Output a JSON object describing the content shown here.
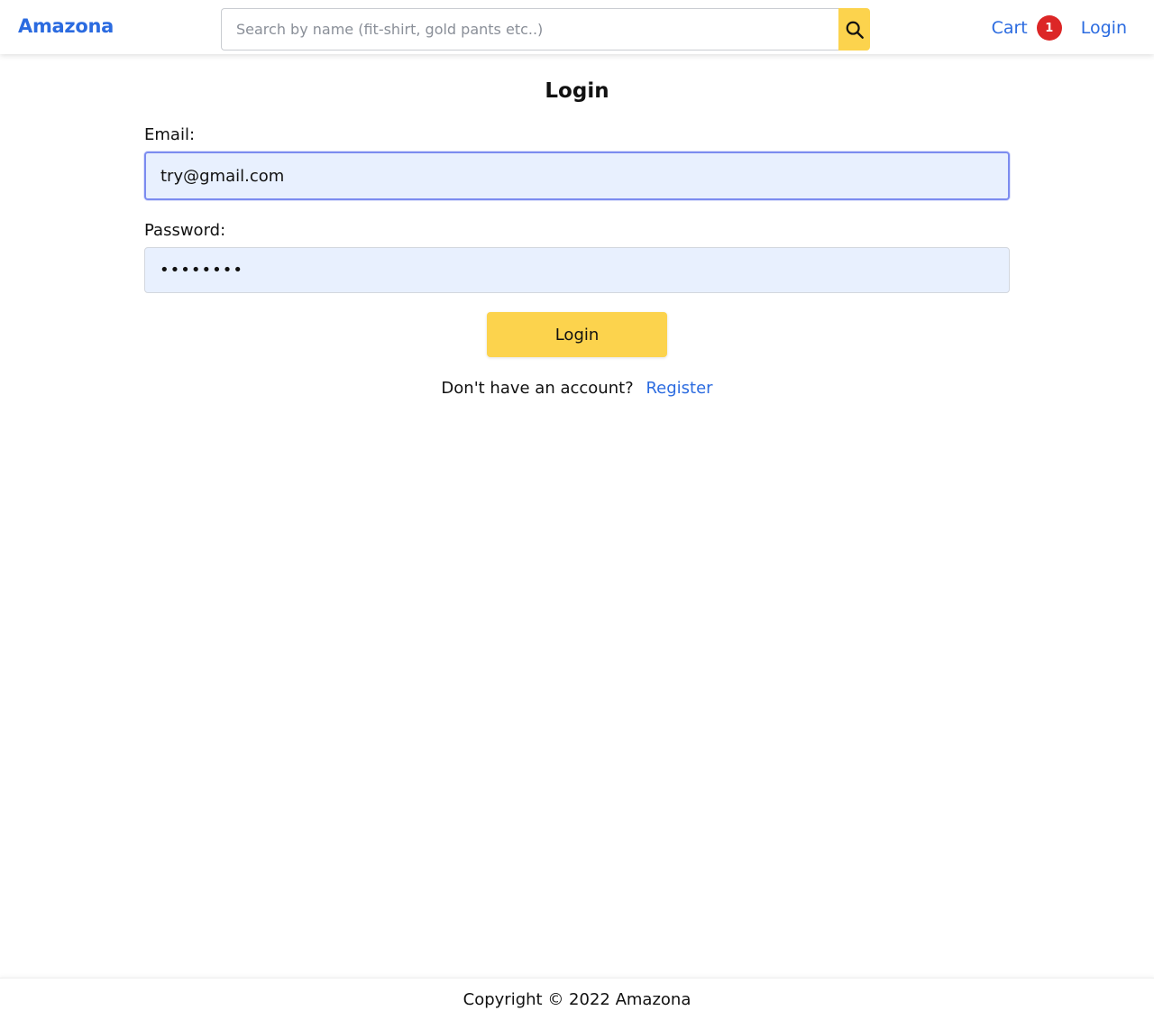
{
  "header": {
    "brand": "Amazona",
    "search": {
      "placeholder": "Search by name (fit-shirt, gold pants etc..)",
      "value": "",
      "button_icon": "search-icon"
    },
    "cart_label": "Cart",
    "cart_count": "1",
    "login_label": "Login"
  },
  "login_form": {
    "title": "Login",
    "email_label": "Email:",
    "email_value": "try@gmail.com",
    "password_label": "Password:",
    "password_value": "••••••••",
    "submit_label": "Login",
    "register_prompt": "Don't have an account?",
    "register_link": "Register"
  },
  "footer": {
    "copyright": "Copyright © 2022 Amazona"
  },
  "colors": {
    "brand": "#2b6be0",
    "accent": "#fcd34d",
    "badge": "#dc2626",
    "input_bg": "#e8f0fe",
    "focus_ring": "#7c8cf0"
  }
}
